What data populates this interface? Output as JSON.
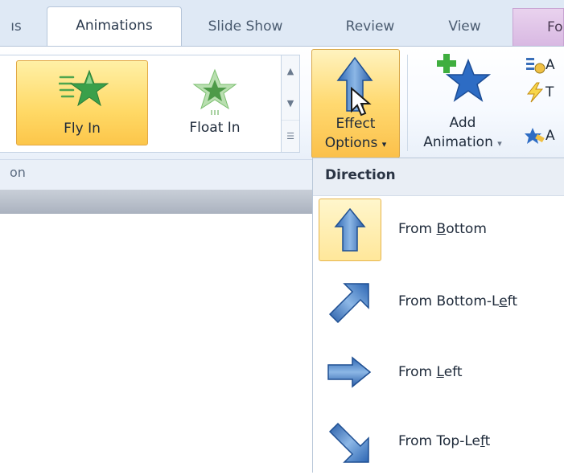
{
  "tabs": {
    "t0": "ıs",
    "t1": "Animations",
    "t2": "Slide Show",
    "t3": "Review",
    "t4": "View",
    "t5": "Fo"
  },
  "gallery": {
    "item1": "Fly In",
    "item2": "Float In"
  },
  "effect_options": {
    "line1": "Effect",
    "line2": "Options",
    "arrow": "▾"
  },
  "add_animation": {
    "line1": "Add",
    "line2": "Animation",
    "arrow": "▾"
  },
  "side_commands": {
    "c1": "A",
    "c2": "T",
    "c3": "A"
  },
  "group_label": "on",
  "menu": {
    "header": "Direction",
    "items": [
      {
        "pre": "From ",
        "key": "B",
        "post": "ottom",
        "icon": "arrow-up-icon"
      },
      {
        "pre": "From Bottom-L",
        "key": "e",
        "post": "ft",
        "icon": "arrow-up-right-icon"
      },
      {
        "pre": "From ",
        "key": "L",
        "post": "eft",
        "icon": "arrow-right-icon"
      },
      {
        "pre": "From Top-Le",
        "key": "f",
        "post": "t",
        "icon": "arrow-down-right-icon"
      }
    ]
  },
  "colors": {
    "accent_gold": "#ffd970",
    "arrow_blue": "#3a78c4",
    "star_green": "#3aa04a"
  }
}
